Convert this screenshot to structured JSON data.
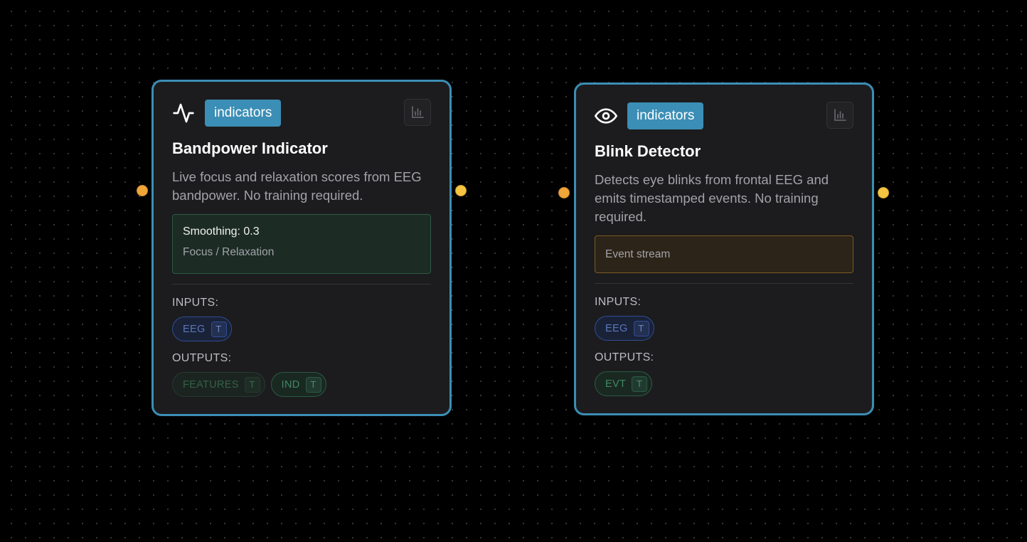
{
  "nodes": [
    {
      "category": "indicators",
      "icon": "activity-icon",
      "title": "Bandpower Indicator",
      "description": "Live focus and relaxation scores from EEG bandpower. No training required.",
      "info": {
        "main": "Smoothing: 0.3",
        "sub": "Focus / Relaxation"
      },
      "inputs_label": "INPUTS:",
      "outputs_label": "OUTPUTS:",
      "inputs": [
        {
          "name": "EEG",
          "type": "T"
        }
      ],
      "outputs": [
        {
          "name": "FEATURES",
          "type": "T"
        },
        {
          "name": "IND",
          "type": "T"
        }
      ]
    },
    {
      "category": "indicators",
      "icon": "eye-icon",
      "title": "Blink Detector",
      "description": "Detects eye blinks from frontal EEG and emits timestamped events. No training required.",
      "info": {
        "main": "Event stream"
      },
      "inputs_label": "INPUTS:",
      "outputs_label": "OUTPUTS:",
      "inputs": [
        {
          "name": "EEG",
          "type": "T"
        }
      ],
      "outputs": [
        {
          "name": "EVT",
          "type": "T"
        }
      ]
    }
  ],
  "colors": {
    "node_border": "#3b8eb5",
    "category_badge": "#3b8eb5",
    "input_handle": "#f0a539",
    "output_handle": "#f5c542",
    "input_port": "#2f4d93",
    "output_port": "#2b5a44"
  }
}
